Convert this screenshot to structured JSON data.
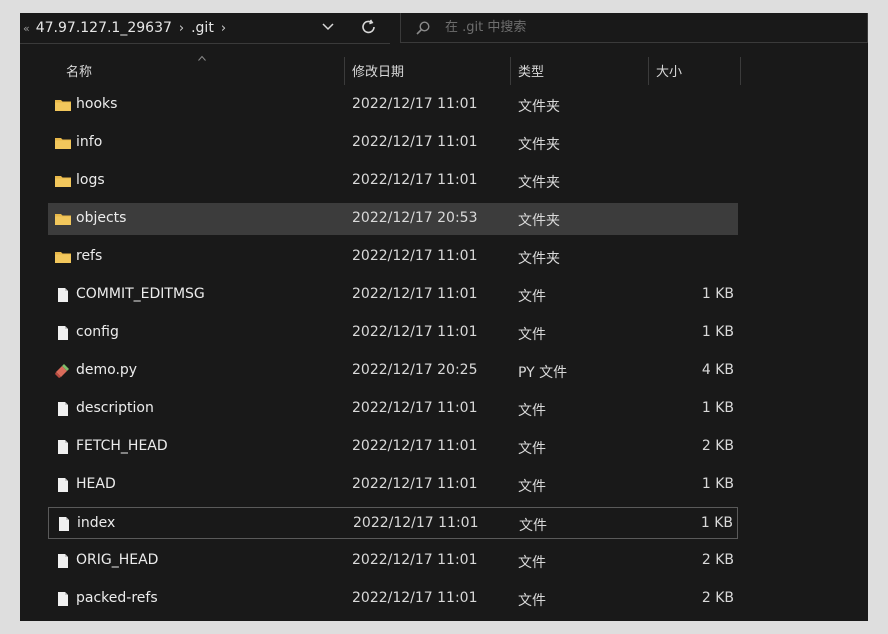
{
  "address_bar": {
    "overflow_glyph": "«",
    "crumbs": [
      "47.97.127.1_29637",
      ".git"
    ],
    "separator": "›"
  },
  "search": {
    "placeholder": "在 .git 中搜索"
  },
  "columns": {
    "name": "名称",
    "date": "修改日期",
    "type": "类型",
    "size": "大小"
  },
  "files": [
    {
      "name": "hooks",
      "date": "2022/12/17 11:01",
      "type": "文件夹",
      "size": "",
      "icon": "folder-icon"
    },
    {
      "name": "info",
      "date": "2022/12/17 11:01",
      "type": "文件夹",
      "size": "",
      "icon": "folder-icon"
    },
    {
      "name": "logs",
      "date": "2022/12/17 11:01",
      "type": "文件夹",
      "size": "",
      "icon": "folder-icon"
    },
    {
      "name": "objects",
      "date": "2022/12/17 20:53",
      "type": "文件夹",
      "size": "",
      "icon": "folder-icon",
      "selected": true
    },
    {
      "name": "refs",
      "date": "2022/12/17 11:01",
      "type": "文件夹",
      "size": "",
      "icon": "folder-icon"
    },
    {
      "name": "COMMIT_EDITMSG",
      "date": "2022/12/17 11:01",
      "type": "文件",
      "size": "1 KB",
      "icon": "file-icon"
    },
    {
      "name": "config",
      "date": "2022/12/17 11:01",
      "type": "文件",
      "size": "1 KB",
      "icon": "file-icon"
    },
    {
      "name": "demo.py",
      "date": "2022/12/17 20:25",
      "type": "PY 文件",
      "size": "4 KB",
      "icon": "python-file-icon"
    },
    {
      "name": "description",
      "date": "2022/12/17 11:01",
      "type": "文件",
      "size": "1 KB",
      "icon": "file-icon"
    },
    {
      "name": "FETCH_HEAD",
      "date": "2022/12/17 11:01",
      "type": "文件",
      "size": "2 KB",
      "icon": "file-icon"
    },
    {
      "name": "HEAD",
      "date": "2022/12/17 11:01",
      "type": "文件",
      "size": "1 KB",
      "icon": "file-icon"
    },
    {
      "name": "index",
      "date": "2022/12/17 11:01",
      "type": "文件",
      "size": "1 KB",
      "icon": "file-icon",
      "focused": true
    },
    {
      "name": "ORIG_HEAD",
      "date": "2022/12/17 11:01",
      "type": "文件",
      "size": "2 KB",
      "icon": "file-icon"
    },
    {
      "name": "packed-refs",
      "date": "2022/12/17 11:01",
      "type": "文件",
      "size": "2 KB",
      "icon": "file-icon"
    }
  ],
  "colors": {
    "window_bg": "#191919",
    "selected_row": "#3c3c3c",
    "folder": "#e8b84a",
    "text": "#ececec"
  }
}
